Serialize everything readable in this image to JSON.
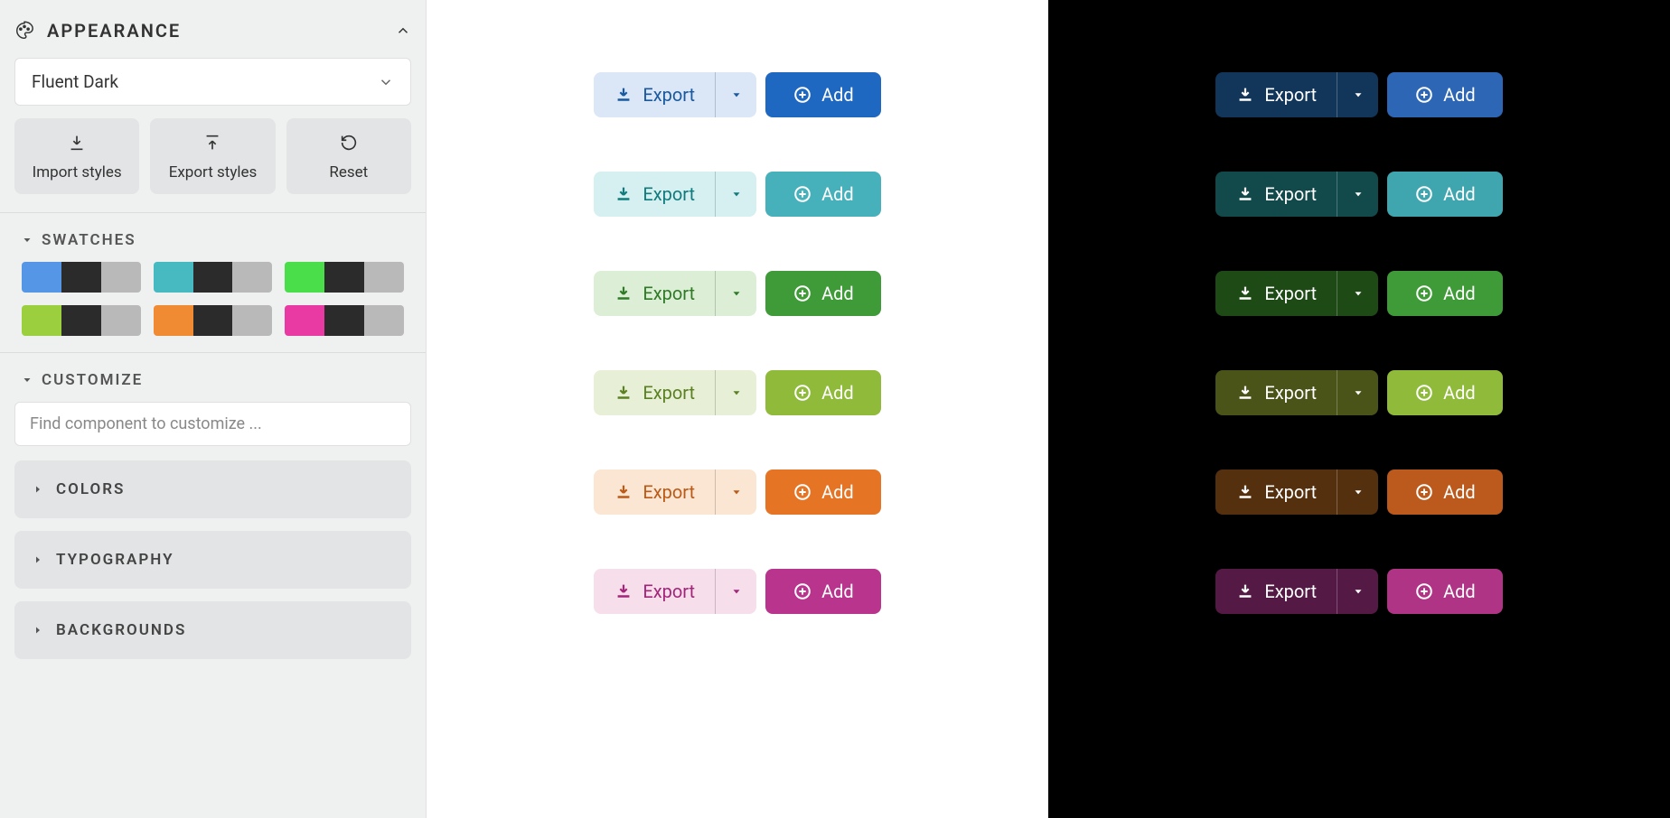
{
  "panel": {
    "title": "APPEARANCE",
    "theme_selected": "Fluent Dark",
    "actions": {
      "import": "Import styles",
      "export": "Export styles",
      "reset": "Reset"
    },
    "swatches_label": "SWATCHES",
    "customize_label": "CUSTOMIZE",
    "search_placeholder": "Find component to customize ...",
    "categories": [
      "COLORS",
      "TYPOGRAPHY",
      "BACKGROUNDS"
    ],
    "swatches": [
      {
        "primary": "#5596e6",
        "mid": "#2b2b2b",
        "neutral": "#b9b9b9"
      },
      {
        "primary": "#47bac1",
        "mid": "#2b2b2b",
        "neutral": "#b9b9b9"
      },
      {
        "primary": "#4ade4a",
        "mid": "#2b2b2b",
        "neutral": "#b9b9b9"
      },
      {
        "primary": "#9bcf3e",
        "mid": "#2b2b2b",
        "neutral": "#b9b9b9"
      },
      {
        "primary": "#f08a33",
        "mid": "#2b2b2b",
        "neutral": "#b9b9b9"
      },
      {
        "primary": "#e93aa3",
        "mid": "#2b2b2b",
        "neutral": "#b9b9b9"
      }
    ]
  },
  "buttons": {
    "export_label": "Export",
    "add_label": "Add"
  },
  "themes_light": [
    {
      "tint": "#dbe7f7",
      "text": "#19599f",
      "solid": "#1f68c1"
    },
    {
      "tint": "#d6eff1",
      "text": "#0f7b7c",
      "solid": "#46b0bb"
    },
    {
      "tint": "#dcefd6",
      "text": "#2e7a26",
      "solid": "#3f9b38"
    },
    {
      "tint": "#e7f0d6",
      "text": "#5b8022",
      "solid": "#8fba3a"
    },
    {
      "tint": "#fae6d2",
      "text": "#bb5a16",
      "solid": "#e67425"
    },
    {
      "tint": "#f6deeb",
      "text": "#a3257a",
      "solid": "#b9348d"
    }
  ],
  "themes_dark": [
    {
      "tint": "#12355a",
      "text": "#ffffff",
      "solid": "#2c66b4"
    },
    {
      "tint": "#12494a",
      "text": "#ffffff",
      "solid": "#3fa6af"
    },
    {
      "tint": "#1e4a16",
      "text": "#ffffff",
      "solid": "#3f9b38"
    },
    {
      "tint": "#4a5418",
      "text": "#ffffff",
      "solid": "#8fba3a"
    },
    {
      "tint": "#55300f",
      "text": "#ffffff",
      "solid": "#bb5a1c"
    },
    {
      "tint": "#541945",
      "text": "#ffffff",
      "solid": "#b03485"
    }
  ]
}
